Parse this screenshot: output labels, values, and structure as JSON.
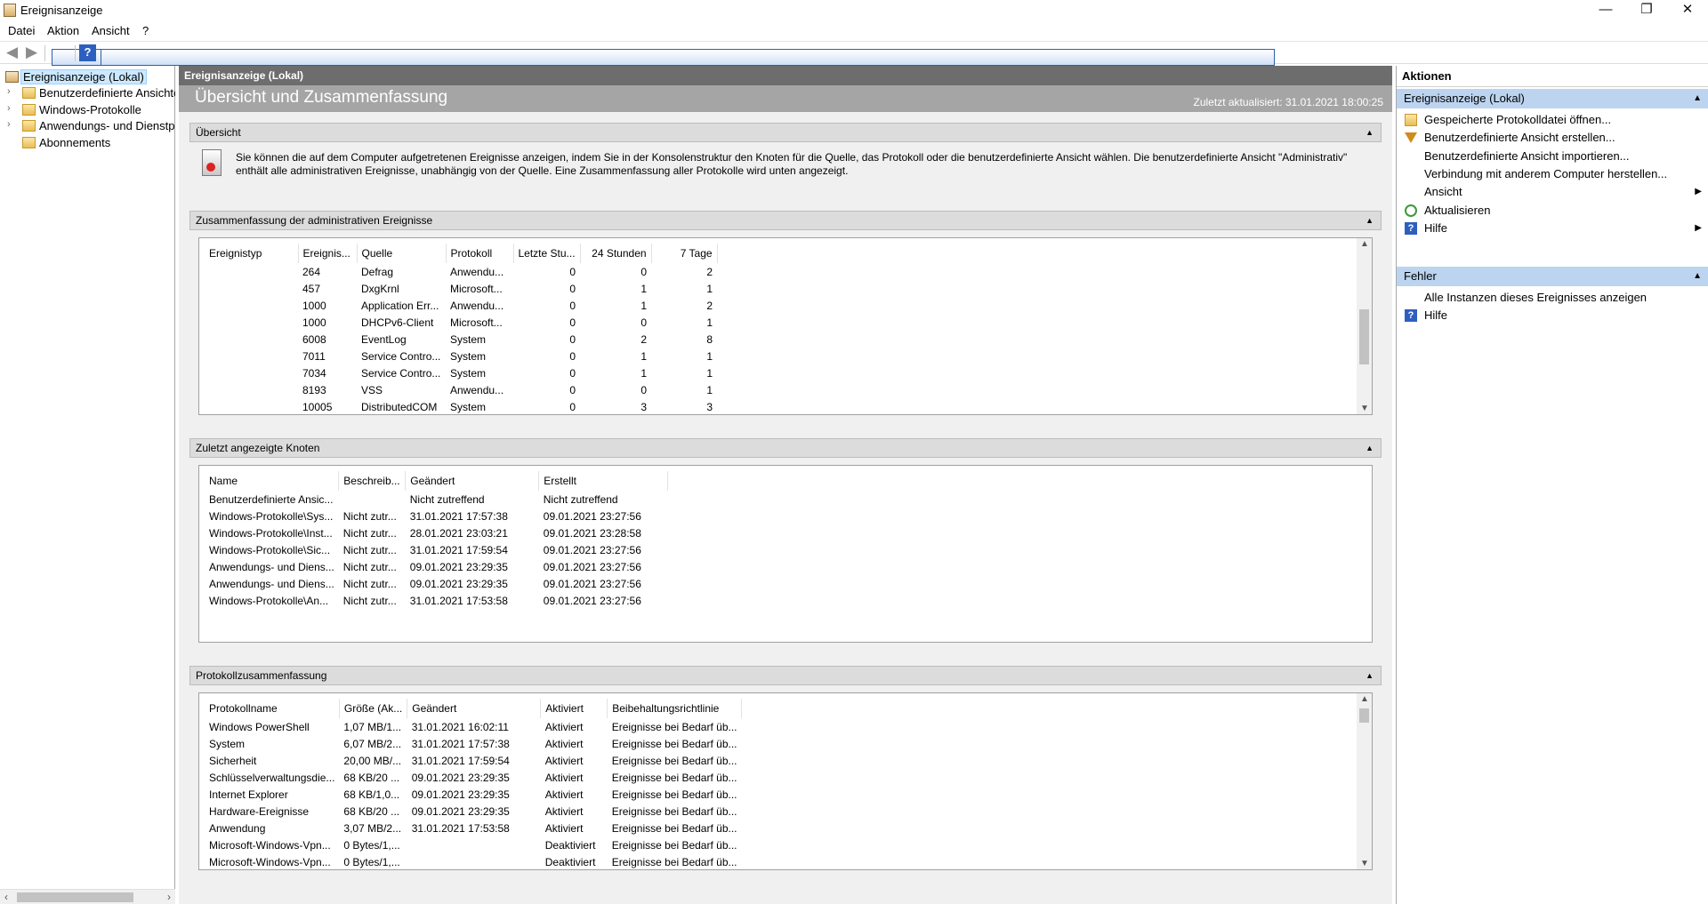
{
  "window": {
    "title": "Ereignisanzeige",
    "minimize": "—",
    "maximize": "❐",
    "close": "✕"
  },
  "menu": {
    "datei": "Datei",
    "aktion": "Aktion",
    "ansicht": "Ansicht",
    "help": "?"
  },
  "tree": [
    {
      "label": "Ereignisanzeige (Lokal)"
    },
    {
      "label": "Benutzerdefinierte Ansichten"
    },
    {
      "label": "Windows-Protokolle"
    },
    {
      "label": "Anwendungs- und Dienstprotokolle"
    },
    {
      "label": "Abonnements"
    }
  ],
  "main": {
    "header": "Ereignisanzeige (Lokal)",
    "banner_title": "Übersicht und Zusammenfassung",
    "last_updated": "Zuletzt aktualisiert: 31.01.2021 18:00:25"
  },
  "overview": {
    "title": "Übersicht",
    "text": "Sie können die auf dem Computer aufgetretenen Ereignisse anzeigen, indem Sie in der Konsolenstruktur den Knoten für die Quelle, das Protokoll oder die benutzerdefinierte Ansicht wählen. Die benutzerdefinierte Ansicht \"Administrativ\" enthält alle administrativen Ereignisse, unabhängig von der Quelle. Eine Zusammenfassung aller Protokolle wird unten angezeigt."
  },
  "admin_summary": {
    "title": "Zusammenfassung der administrativen Ereignisse",
    "columns": [
      "Ereignistyp",
      "Ereignis...",
      "Quelle",
      "Protokoll",
      "Letzte Stu...",
      "24 Stunden",
      "7 Tage"
    ],
    "rows": [
      [
        "",
        "264",
        "Defrag",
        "Anwendu...",
        "0",
        "0",
        "2"
      ],
      [
        "",
        "457",
        "DxgKrnl",
        "Microsoft...",
        "0",
        "1",
        "1"
      ],
      [
        "",
        "1000",
        "Application Err...",
        "Anwendu...",
        "0",
        "1",
        "2"
      ],
      [
        "",
        "1000",
        "DHCPv6-Client",
        "Microsoft...",
        "0",
        "0",
        "1"
      ],
      [
        "",
        "6008",
        "EventLog",
        "System",
        "0",
        "2",
        "8"
      ],
      [
        "",
        "7011",
        "Service Contro...",
        "System",
        "0",
        "1",
        "1"
      ],
      [
        "",
        "7034",
        "Service Contro...",
        "System",
        "0",
        "1",
        "1"
      ],
      [
        "",
        "8193",
        "VSS",
        "Anwendu...",
        "0",
        "0",
        "1"
      ],
      [
        "",
        "10005",
        "DistributedCOM",
        "System",
        "0",
        "3",
        "3"
      ]
    ]
  },
  "recent_nodes": {
    "title": "Zuletzt angezeigte Knoten",
    "columns": [
      "Name",
      "Beschreib...",
      "Geändert",
      "Erstellt"
    ],
    "rows": [
      [
        "Benutzerdefinierte Ansic...",
        "",
        "Nicht zutreffend",
        "Nicht zutreffend"
      ],
      [
        "Windows-Protokolle\\Sys...",
        "Nicht zutr...",
        "31.01.2021 17:57:38",
        "09.01.2021 23:27:56"
      ],
      [
        "Windows-Protokolle\\Inst...",
        "Nicht zutr...",
        "28.01.2021 23:03:21",
        "09.01.2021 23:28:58"
      ],
      [
        "Windows-Protokolle\\Sic...",
        "Nicht zutr...",
        "31.01.2021 17:59:54",
        "09.01.2021 23:27:56"
      ],
      [
        "Anwendungs- und Diens...",
        "Nicht zutr...",
        "09.01.2021 23:29:35",
        "09.01.2021 23:27:56"
      ],
      [
        "Anwendungs- und Diens...",
        "Nicht zutr...",
        "09.01.2021 23:29:35",
        "09.01.2021 23:27:56"
      ],
      [
        "Windows-Protokolle\\An...",
        "Nicht zutr...",
        "31.01.2021 17:53:58",
        "09.01.2021 23:27:56"
      ]
    ]
  },
  "log_summary": {
    "title": "Protokollzusammenfassung",
    "columns": [
      "Protokollname",
      "Größe (Ak...",
      "Geändert",
      "Aktiviert",
      "Beibehaltungsrichtlinie"
    ],
    "rows": [
      [
        "Windows PowerShell",
        "1,07 MB/1...",
        "31.01.2021 16:02:11",
        "Aktiviert",
        "Ereignisse bei Bedarf üb..."
      ],
      [
        "System",
        "6,07 MB/2...",
        "31.01.2021 17:57:38",
        "Aktiviert",
        "Ereignisse bei Bedarf üb..."
      ],
      [
        "Sicherheit",
        "20,00 MB/...",
        "31.01.2021 17:59:54",
        "Aktiviert",
        "Ereignisse bei Bedarf üb..."
      ],
      [
        "Schlüsselverwaltungsdie...",
        "68 KB/20 ...",
        "09.01.2021 23:29:35",
        "Aktiviert",
        "Ereignisse bei Bedarf üb..."
      ],
      [
        "Internet Explorer",
        "68 KB/1,0...",
        "09.01.2021 23:29:35",
        "Aktiviert",
        "Ereignisse bei Bedarf üb..."
      ],
      [
        "Hardware-Ereignisse",
        "68 KB/20 ...",
        "09.01.2021 23:29:35",
        "Aktiviert",
        "Ereignisse bei Bedarf üb..."
      ],
      [
        "Anwendung",
        "3,07 MB/2...",
        "31.01.2021 17:53:58",
        "Aktiviert",
        "Ereignisse bei Bedarf üb..."
      ],
      [
        "Microsoft-Windows-Vpn...",
        "0 Bytes/1,...",
        "",
        "Deaktiviert",
        "Ereignisse bei Bedarf üb..."
      ],
      [
        "Microsoft-Windows-Vpn...",
        "0 Bytes/1,...",
        "",
        "Deaktiviert",
        "Ereignisse bei Bedarf üb..."
      ]
    ]
  },
  "actions": {
    "title": "Aktionen",
    "group1": "Ereignisanzeige (Lokal)",
    "items1": [
      {
        "label": "Gespeicherte Protokolldatei öffnen...",
        "icon": "open-folder-icon"
      },
      {
        "label": "Benutzerdefinierte Ansicht erstellen...",
        "icon": "filter-icon"
      },
      {
        "label": "Benutzerdefinierte Ansicht importieren...",
        "icon": ""
      },
      {
        "label": "Verbindung mit anderem Computer herstellen...",
        "icon": ""
      },
      {
        "label": "Ansicht",
        "icon": ""
      },
      {
        "label": "Aktualisieren",
        "icon": "refresh-icon"
      },
      {
        "label": "Hilfe",
        "icon": "help-icon"
      }
    ],
    "group2": "Fehler",
    "items2": [
      {
        "label": "Alle Instanzen dieses Ereignisses anzeigen",
        "icon": ""
      },
      {
        "label": "Hilfe",
        "icon": "help-icon"
      }
    ]
  }
}
